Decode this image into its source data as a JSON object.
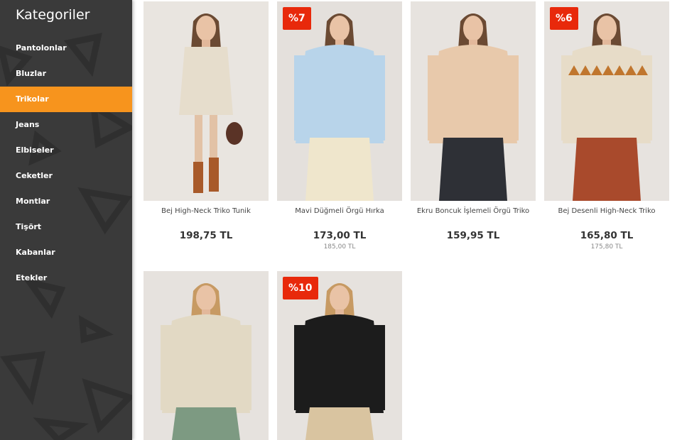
{
  "sidebar": {
    "title": "Kategoriler",
    "items": [
      {
        "label": "Pantolonlar",
        "active": false
      },
      {
        "label": "Bluzlar",
        "active": false
      },
      {
        "label": "Trikolar",
        "active": true
      },
      {
        "label": "Jeans",
        "active": false
      },
      {
        "label": "Elbiseler",
        "active": false
      },
      {
        "label": "Ceketler",
        "active": false
      },
      {
        "label": "Montlar",
        "active": false
      },
      {
        "label": "Tişört",
        "active": false
      },
      {
        "label": "Kabanlar",
        "active": false
      },
      {
        "label": "Etekler",
        "active": false
      }
    ],
    "colors": {
      "background": "#3a3a3a",
      "active": "#f7941d"
    }
  },
  "products": [
    {
      "name": "Bej High-Neck Triko Tunik",
      "price": "198,75 TL",
      "old_price": "",
      "badge": "",
      "bg": "#e9e5e0",
      "garment": "#e6ddcc",
      "pants": "",
      "legs": "#e2c2a6"
    },
    {
      "name": "Mavi Düğmeli Örgü Hırka",
      "price": "173,00 TL",
      "old_price": "185,00 TL",
      "badge": "%7",
      "bg": "#e4e0dc",
      "garment": "#b8d4ea",
      "pants": "#efe6cc",
      "legs": ""
    },
    {
      "name": "Ekru Boncuk İşlemeli Örgü Triko",
      "price": "159,95 TL",
      "old_price": "",
      "badge": "",
      "bg": "#e7e3df",
      "garment": "#e8c9ab",
      "pants": "#2e3036",
      "legs": ""
    },
    {
      "name": "Bej Desenli High-Neck Triko",
      "price": "165,80 TL",
      "old_price": "175,80 TL",
      "badge": "%6",
      "bg": "#e7e3df",
      "garment": "#e7dcc8",
      "pants": "#a94a2c",
      "legs": ""
    },
    {
      "name": "",
      "price": "",
      "old_price": "",
      "badge": "",
      "bg": "#e6e2de",
      "garment": "#e2d9c4",
      "pants": "#7d9a82",
      "legs": ""
    },
    {
      "name": "",
      "price": "",
      "old_price": "",
      "badge": "%10",
      "bg": "#e6e2de",
      "garment": "#1c1c1c",
      "pants": "#d9c4a0",
      "legs": ""
    }
  ],
  "colors": {
    "badge": "#e8290b",
    "accent": "#f7941d"
  }
}
